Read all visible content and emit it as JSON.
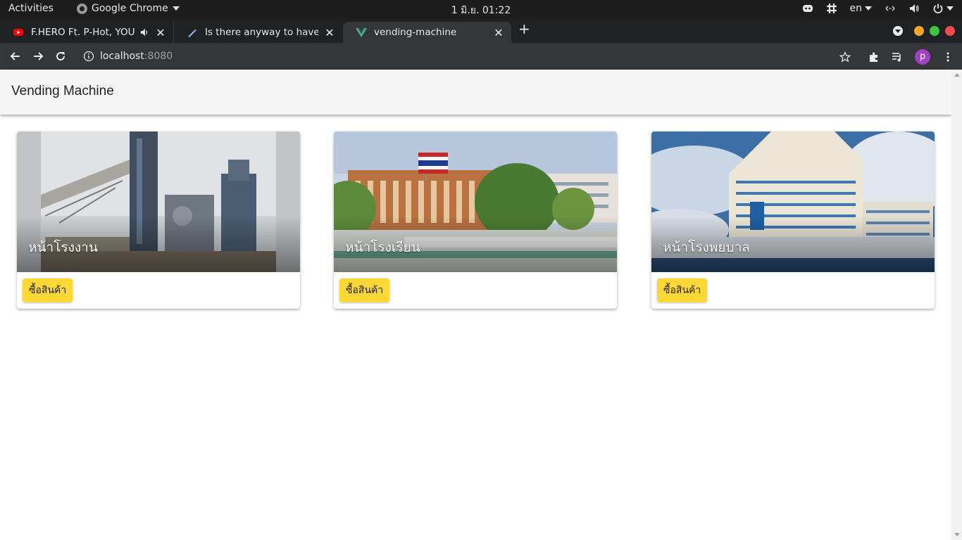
{
  "system": {
    "activities": "Activities",
    "app_name": "Google Chrome",
    "clock": "1 มิ.ย.  01:22",
    "language": "en"
  },
  "browser": {
    "tabs": [
      {
        "title": "F.HERO Ft. P-Hot, YOUNGOHM",
        "icon": "youtube-icon",
        "audio": true
      },
      {
        "title": "Is there anyway to have Vuetify",
        "icon": "pencil-icon"
      },
      {
        "title": "vending-machine",
        "icon": "vue-icon",
        "active": true
      }
    ],
    "url_host": "localhost",
    "url_port": ":8080",
    "profile_initial": "p"
  },
  "app": {
    "title": "Vending Machine",
    "cards": [
      {
        "caption": "หน้าโรงงาน",
        "button": "ซื้อสินค้า",
        "image": "factory"
      },
      {
        "caption": "หน้าโรงเรียน",
        "button": "ซื้อสินค้า",
        "image": "school"
      },
      {
        "caption": "หน้าโรงพยบาล",
        "button": "ซื้อสินค้า",
        "image": "hospital"
      }
    ]
  },
  "colors": {
    "button": "#fdd835",
    "appbar": "#f5f5f5",
    "chrome_dark": "#202124"
  }
}
